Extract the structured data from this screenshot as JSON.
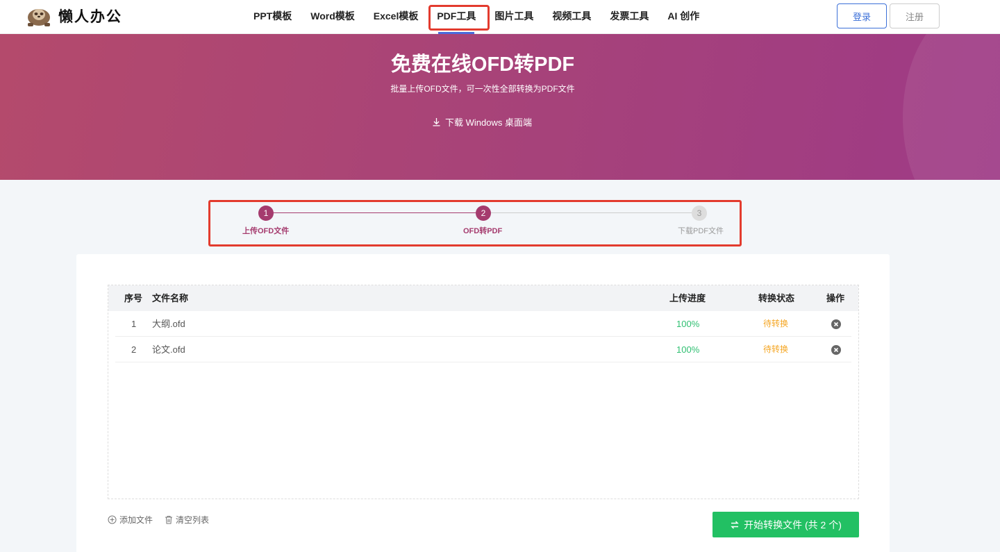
{
  "header": {
    "logo_text": "懒人办公",
    "nav": [
      {
        "label": "PPT模板"
      },
      {
        "label": "Word模板"
      },
      {
        "label": "Excel模板"
      },
      {
        "label": "PDF工具"
      },
      {
        "label": "图片工具"
      },
      {
        "label": "视频工具"
      },
      {
        "label": "发票工具"
      },
      {
        "label": "AI 创作"
      }
    ],
    "login_label": "登录",
    "register_label": "注册"
  },
  "banner": {
    "title": "免费在线OFD转PDF",
    "subtitle": "批量上传OFD文件，可一次性全部转换为PDF文件",
    "download_label": "下载 Windows 桌面端"
  },
  "steps": [
    {
      "num": "1",
      "label": "上传OFD文件",
      "state": "done"
    },
    {
      "num": "2",
      "label": "OFD转PDF",
      "state": "done"
    },
    {
      "num": "3",
      "label": "下载PDF文件",
      "state": "todo"
    }
  ],
  "table": {
    "headers": {
      "idx": "序号",
      "name": "文件名称",
      "progress": "上传进度",
      "status": "转换状态",
      "op": "操作"
    },
    "rows": [
      {
        "idx": "1",
        "name": "大纲.ofd",
        "progress": "100%",
        "status": "待转换"
      },
      {
        "idx": "2",
        "name": "论文.ofd",
        "progress": "100%",
        "status": "待转换"
      }
    ]
  },
  "actions": {
    "add_file": "添加文件",
    "clear_list": "清空列表",
    "start_label": "开始转换文件 (共 2 个)"
  },
  "colors": {
    "accent": "#a53b6e",
    "success": "#22c063",
    "pending": "#f5a623",
    "highlight": "#e33b2e",
    "link": "#3b6fd8"
  }
}
